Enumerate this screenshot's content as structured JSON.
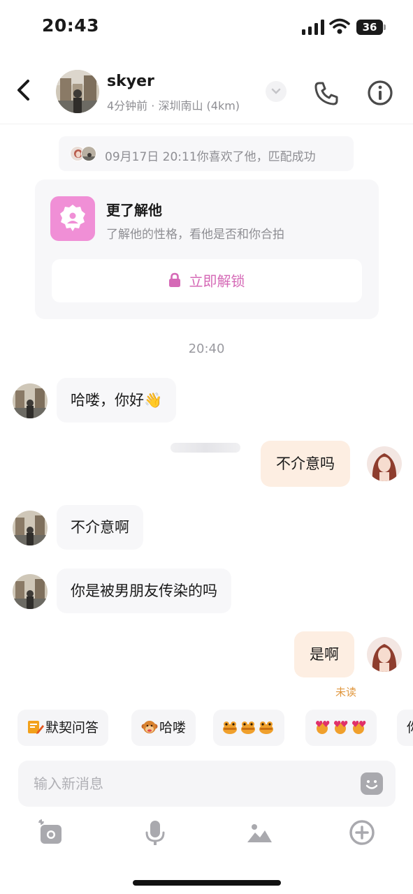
{
  "status_bar": {
    "time": "20:43",
    "battery": "36"
  },
  "header": {
    "name": "skyer",
    "subtitle": "4分钟前 · 深圳南山 (4km)",
    "back_icon": "chevron-left-icon",
    "call_icon": "phone-icon",
    "info_icon": "info-icon"
  },
  "match": {
    "text": "09月17日 20:11你喜欢了他，匹配成功"
  },
  "card": {
    "title": "更了解他",
    "description": "了解他的性格，看他是否和你合拍",
    "button_label": "立即解锁",
    "accent": "#d569b6"
  },
  "time_separator": "20:40",
  "messages": [
    {
      "side": "in",
      "text": "哈喽，你好👋"
    },
    {
      "side": "out",
      "text": "不介意吗"
    },
    {
      "side": "in",
      "text": "不介意啊"
    },
    {
      "side": "in",
      "text": "你是被男朋友传染的吗"
    },
    {
      "side": "out",
      "text": "是啊",
      "status": "未读"
    }
  ],
  "quick_replies": [
    {
      "label": "默契问答",
      "icon": "pencil-note-icon"
    },
    {
      "label": "哈喽",
      "icon": "monkey-emoji-icon"
    },
    {
      "label": "",
      "icon": "frog-emoji-icon"
    },
    {
      "label": "",
      "icon": "heart-emoji-icon"
    },
    {
      "label": "你"
    }
  ],
  "input": {
    "placeholder": "输入新消息"
  },
  "toolbar": [
    "camera-icon",
    "microphone-icon",
    "image-icon",
    "plus-circle-icon"
  ],
  "colors": {
    "outgoing_bubble": "#fdeee2",
    "incoming_bubble": "#f7f7f9",
    "unread": "#e0963c"
  }
}
